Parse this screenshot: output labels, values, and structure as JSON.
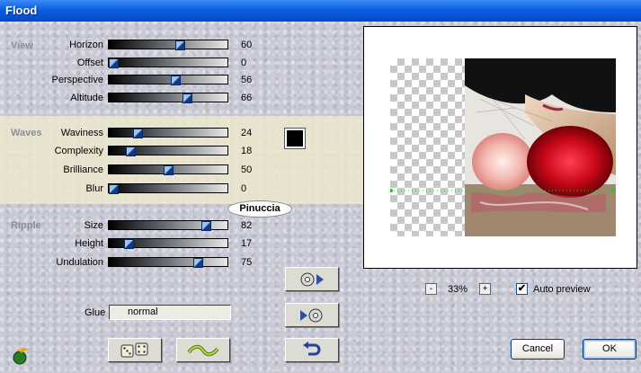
{
  "window": {
    "title": "Flood"
  },
  "sections": {
    "view": "View",
    "waves": "Waves",
    "ripple": "Ripple"
  },
  "sliders": [
    {
      "id": "horizon",
      "label": "Horizon",
      "value": "60",
      "fraction": 0.6
    },
    {
      "id": "offset",
      "label": "Offset",
      "value": "0",
      "fraction": 0.0
    },
    {
      "id": "perspective",
      "label": "Perspective",
      "value": "56",
      "fraction": 0.56
    },
    {
      "id": "altitude",
      "label": "Altitude",
      "value": "66",
      "fraction": 0.66
    },
    {
      "id": "waviness",
      "label": "Waviness",
      "value": "24",
      "fraction": 0.24
    },
    {
      "id": "complexity",
      "label": "Complexity",
      "value": "18",
      "fraction": 0.18
    },
    {
      "id": "brilliance",
      "label": "Brilliance",
      "value": "50",
      "fraction": 0.5
    },
    {
      "id": "blur",
      "label": "Blur",
      "value": "0",
      "fraction": 0.0
    },
    {
      "id": "size",
      "label": "Size",
      "value": "82",
      "fraction": 0.82
    },
    {
      "id": "height",
      "label": "Height",
      "value": "17",
      "fraction": 0.17
    },
    {
      "id": "undulation",
      "label": "Undulation",
      "value": "75",
      "fraction": 0.75
    }
  ],
  "wave_color": "#000000",
  "watermark": "Pinuccia",
  "glue": {
    "label": "Glue",
    "value": "normal"
  },
  "zoom": {
    "minus": "-",
    "value": "33%",
    "plus": "+"
  },
  "auto_preview": {
    "label": "Auto preview",
    "checked": true,
    "mark": "✔"
  },
  "buttons": {
    "cancel": "Cancel",
    "ok": "OK"
  },
  "colors": {
    "titlebar": "#0a5ee0",
    "waves_band": "#ece8cd",
    "thumb": "#0d3a8a"
  }
}
